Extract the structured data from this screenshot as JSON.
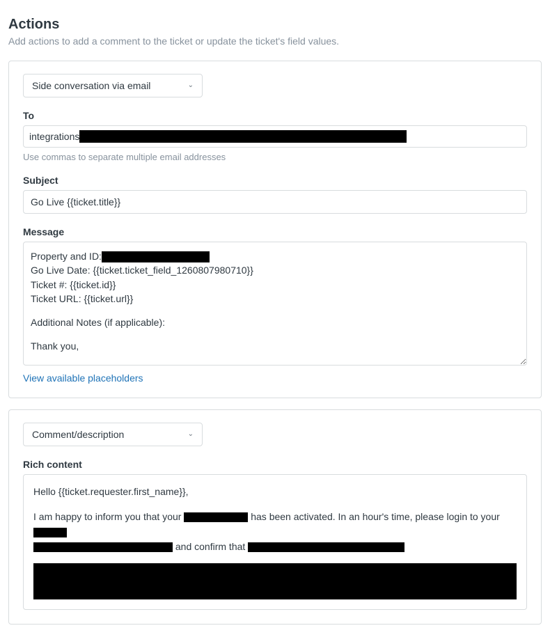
{
  "header": {
    "title": "Actions",
    "subtitle": "Add actions to add a comment to the ticket or update the ticket's field values."
  },
  "action1": {
    "type_label": "Side conversation via email",
    "to_label": "To",
    "to_value_visible": "integrations",
    "to_helper": "Use commas to separate multiple email addresses",
    "subject_label": "Subject",
    "subject_value": "Go Live {{ticket.title}}",
    "message_label": "Message",
    "message_lines": {
      "l1a": "Property and ID:",
      "l2": "Go Live Date: {{ticket.ticket_field_1260807980710}}",
      "l3": "Ticket #: {{ticket.id}}",
      "l4": "Ticket URL: {{ticket.url}}",
      "l5": "Additional Notes (if applicable):",
      "l6": "Thank you,"
    },
    "placeholders_link": "View available placeholders"
  },
  "action2": {
    "type_label": "Comment/description",
    "rich_label": "Rich content",
    "body": {
      "greeting": "Hello {{ticket.requester.first_name}},",
      "p1a": "I am happy to inform you that your ",
      "p1b": " has been activated. In an hour's time, please login to your ",
      "p2a": " and confirm that "
    }
  }
}
